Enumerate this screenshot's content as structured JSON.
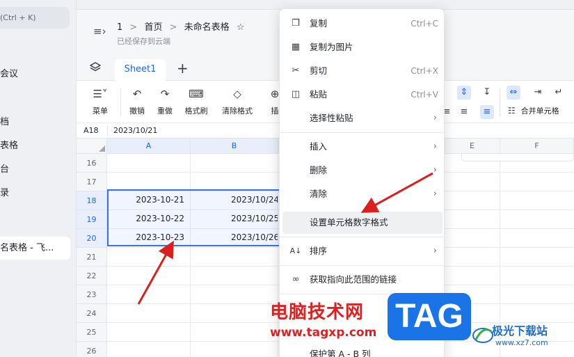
{
  "sidebar": {
    "search_shortcut": "(Ctrl + K)",
    "items": [
      "会议",
      "档",
      "表格",
      "台",
      "录"
    ],
    "active_item": "名表格 - 飞..."
  },
  "header": {
    "crumbs": [
      "1",
      ">",
      "首页",
      ">",
      "未命名表格"
    ],
    "saved_status": "已经保存到云端"
  },
  "tabs": {
    "sheet_name": "Sheet1",
    "add": "+"
  },
  "toolbar": {
    "menu": "菜单",
    "undo": "撤销",
    "redo": "重做",
    "format_painter": "格式刷",
    "clear_format": "清除格式",
    "partial": "插",
    "merge_cells": "合并单元格"
  },
  "formula_bar": {
    "cell_ref": "A18",
    "value": "2023/10/21"
  },
  "grid": {
    "columns": [
      "A",
      "B",
      "E",
      "F"
    ],
    "rows": [
      "16",
      "17",
      "18",
      "19",
      "20",
      "21",
      "22",
      "23",
      "24",
      "25",
      "26"
    ],
    "col_a_values": [
      "2023-10-21",
      "2023-10-22",
      "2023-10-23"
    ],
    "col_b_values": [
      "2023/10/24",
      "2023/10/25",
      "2023/10/26"
    ]
  },
  "context_menu": {
    "items": [
      {
        "label": "复制",
        "shortcut": "Ctrl+C",
        "icon": "copy-icon"
      },
      {
        "label": "复制为图片",
        "shortcut": "",
        "icon": "image-icon"
      },
      {
        "label": "剪切",
        "shortcut": "Ctrl+X",
        "icon": "scissors-icon"
      },
      {
        "label": "粘贴",
        "shortcut": "Ctrl+V",
        "icon": "paste-icon"
      },
      {
        "label": "选择性粘贴",
        "shortcut": "",
        "icon": ""
      },
      {
        "label": "插入",
        "shortcut": "",
        "icon": ""
      },
      {
        "label": "删除",
        "shortcut": "",
        "icon": ""
      },
      {
        "label": "清除",
        "shortcut": "",
        "icon": ""
      },
      {
        "label": "设置单元格数字格式",
        "shortcut": "",
        "icon": ""
      },
      {
        "label": "排序",
        "shortcut": "",
        "icon": "sort-icon"
      },
      {
        "label": "获取指向此范围的链接",
        "shortcut": "",
        "icon": "link-icon"
      },
      {
        "label": "保护第 A - B 列",
        "shortcut": "",
        "icon": ""
      }
    ]
  },
  "watermark": {
    "site_text": "电脑技术网",
    "site_url": "www.tagxp.com",
    "tag": "TAG",
    "logo_text": "极光下载站",
    "logo_url": "www.xz7.com"
  },
  "colors": {
    "accent": "#3370ff",
    "arrow": "#d9201f"
  }
}
